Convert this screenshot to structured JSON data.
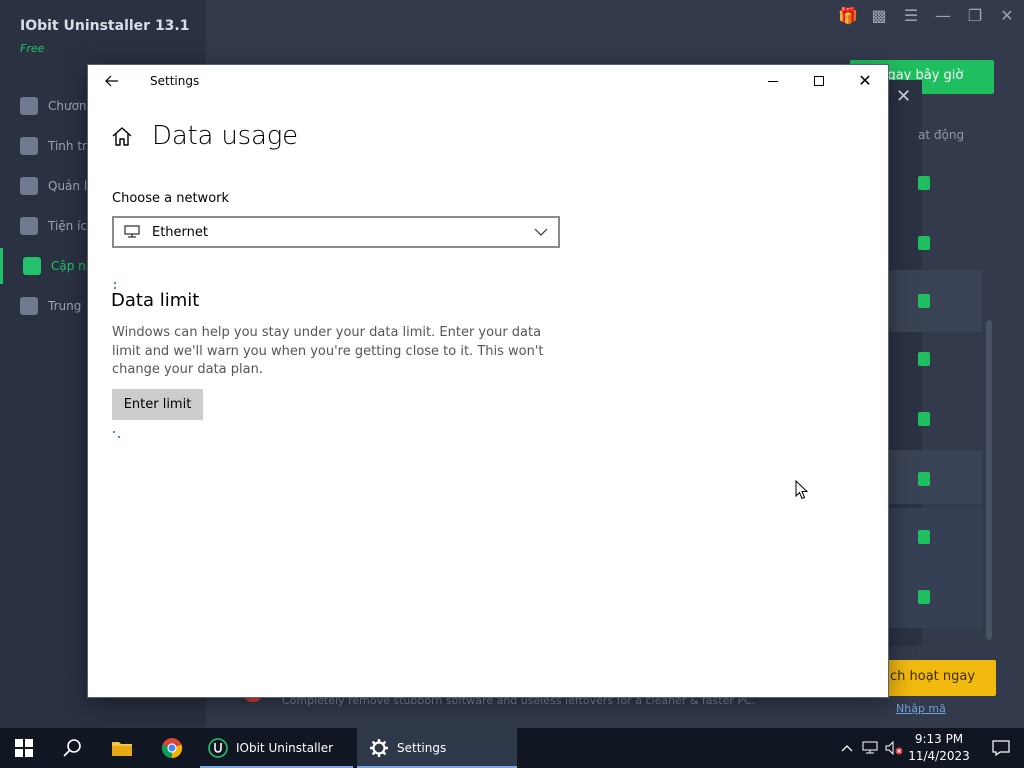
{
  "background_app": {
    "title": "IObit Uninstaller 13.1",
    "edition": "Free",
    "nav_items": [
      "Chươn",
      "Tinh tr",
      "Quản l",
      "Tiện íc",
      "Cập nh",
      "Trung"
    ],
    "active_index": 4,
    "primary_button": "t ngay bây giờ",
    "status_header": "at động",
    "activate_button": "ch hoạt ngay",
    "link_text": "Nhập mã",
    "promo_text": "Completely remove stubborn software and useless leftovers for a cleaner & faster PC.",
    "accent_color": "#23c16b",
    "activate_color": "#f2b90f"
  },
  "settings": {
    "window_title": "Settings",
    "back_icon": "back-arrow-icon",
    "page_title": "Data usage",
    "network_label": "Choose a network",
    "network_value": "Ethernet",
    "section_title": "Data limit",
    "description": "Windows can help you stay under your data limit. Enter your data limit and we'll warn you when you're getting close to it. This won't change your data plan.",
    "enter_limit_button": "Enter limit",
    "accent_color": "#0078d4"
  },
  "taskbar": {
    "apps": [
      {
        "label": "IObit Uninstaller",
        "icon": "iobit-icon"
      },
      {
        "label": "Settings",
        "icon": "gear-icon"
      }
    ],
    "time": "9:13 PM",
    "date": "11/4/2023"
  }
}
